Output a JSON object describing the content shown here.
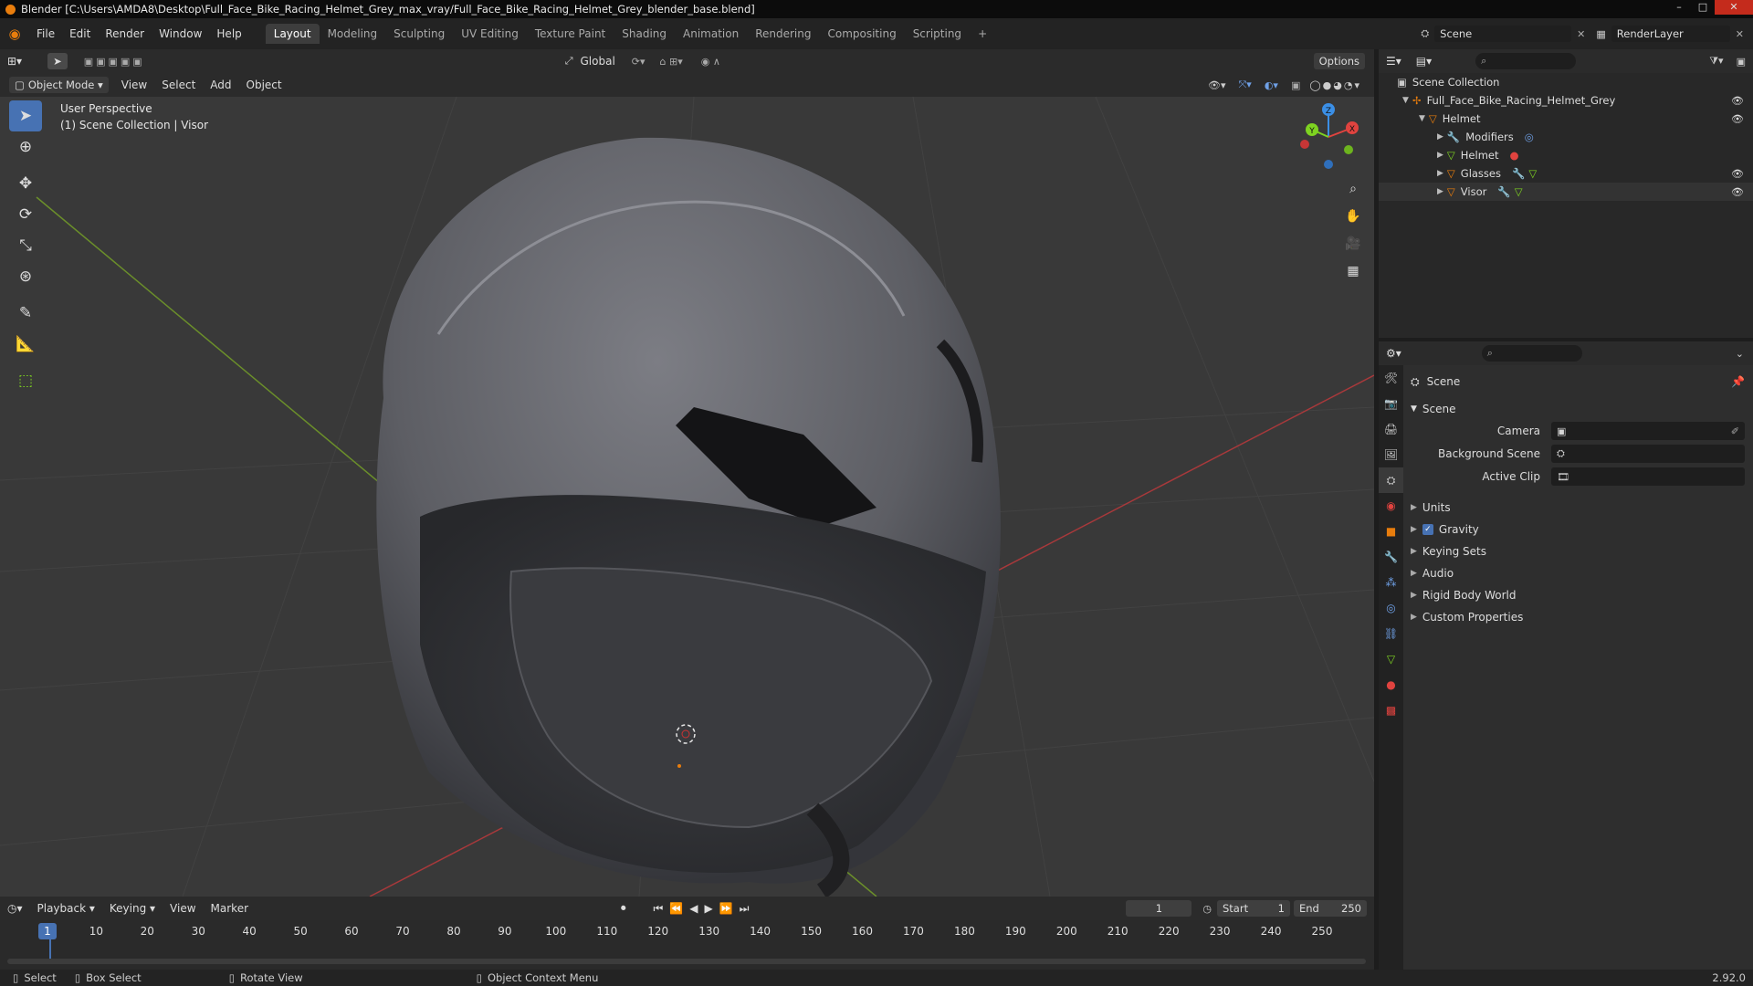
{
  "window": {
    "title": "Blender [C:\\Users\\AMDA8\\Desktop\\Full_Face_Bike_Racing_Helmet_Grey_max_vray/Full_Face_Bike_Racing_Helmet_Grey_blender_base.blend]",
    "controls": [
      "–",
      "□",
      "✕"
    ]
  },
  "menu": [
    "File",
    "Edit",
    "Render",
    "Window",
    "Help"
  ],
  "workspaces": [
    "Layout",
    "Modeling",
    "Sculpting",
    "UV Editing",
    "Texture Paint",
    "Shading",
    "Animation",
    "Rendering",
    "Compositing",
    "Scripting",
    "+"
  ],
  "active_workspace": "Layout",
  "scene_selector": "Scene",
  "render_layer": "RenderLayer",
  "tool_header": {
    "orientation": "Global",
    "options": "Options"
  },
  "viewport_header": {
    "mode": "Object Mode",
    "menus": [
      "View",
      "Select",
      "Add",
      "Object"
    ]
  },
  "viewport": {
    "perspective": "User Perspective",
    "collection": "(1) Scene Collection | Visor"
  },
  "gizmo": {
    "x": "X",
    "y": "Y",
    "z": "Z"
  },
  "outliner": {
    "root": "Scene Collection",
    "items": [
      {
        "label": "Full_Face_Bike_Racing_Helmet_Grey",
        "depth": 1,
        "expanded": true,
        "visible": true
      },
      {
        "label": "Helmet",
        "depth": 2,
        "expanded": true,
        "visible": true
      },
      {
        "label": "Modifiers",
        "depth": 3,
        "expanded": false,
        "visible": false
      },
      {
        "label": "Helmet",
        "depth": 3,
        "expanded": false,
        "visible": false
      },
      {
        "label": "Glasses",
        "depth": 3,
        "expanded": false,
        "visible": true
      },
      {
        "label": "Visor",
        "depth": 3,
        "expanded": false,
        "visible": true
      }
    ]
  },
  "properties": {
    "context": "Scene",
    "panel": "Scene",
    "fields": [
      {
        "label": "Camera",
        "value": ""
      },
      {
        "label": "Background Scene",
        "value": ""
      },
      {
        "label": "Active Clip",
        "value": ""
      }
    ],
    "sections": [
      "Units",
      "Gravity",
      "Keying Sets",
      "Audio",
      "Rigid Body World",
      "Custom Properties"
    ],
    "gravity_checked": true
  },
  "timeline": {
    "menus": [
      "Playback",
      "Keying",
      "View",
      "Marker"
    ],
    "current_frame": "1",
    "start_label": "Start",
    "start": "1",
    "end_label": "End",
    "end": "250",
    "playhead": "1",
    "ticks": [
      10,
      20,
      30,
      40,
      50,
      60,
      70,
      80,
      90,
      100,
      110,
      120,
      130,
      140,
      150,
      160,
      170,
      180,
      190,
      200,
      210,
      220,
      230,
      240,
      250
    ]
  },
  "statusbar": {
    "select": "Select",
    "box_select": "Box Select",
    "rotate_view": "Rotate View",
    "context_menu": "Object Context Menu",
    "version": "2.92.0"
  },
  "colors": {
    "accent": "#4772b3",
    "x_axis": "#e0433f",
    "y_axis": "#7ed321",
    "z_axis": "#3b8fe6",
    "orange": "#e87d0d"
  }
}
